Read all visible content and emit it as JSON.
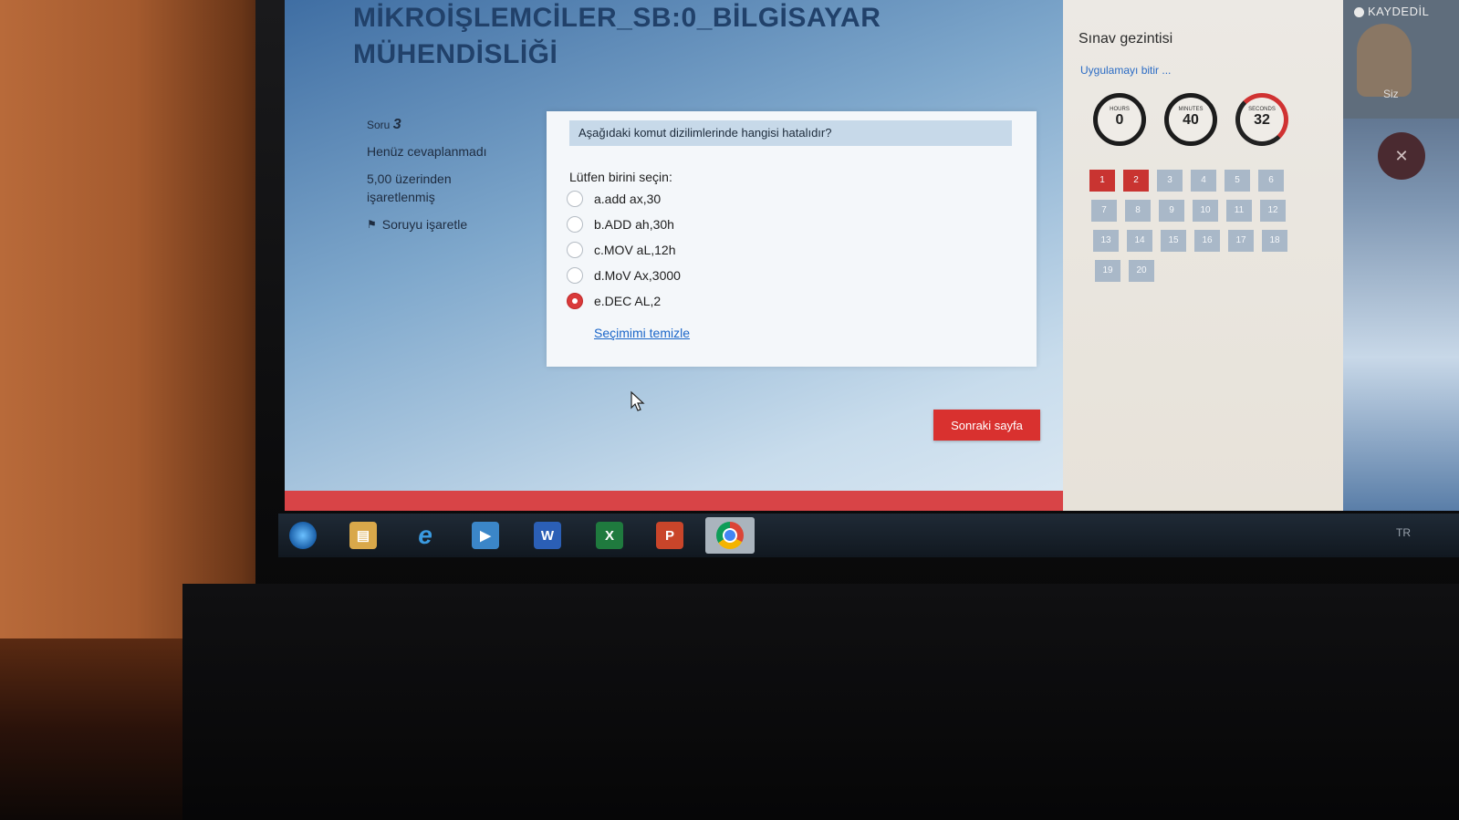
{
  "page": {
    "title_line1": "MİKROİŞLEMCİLER_SB:0_BİLGİSAYAR",
    "title_line2": "MÜHENDİSLİĞİ"
  },
  "question_info": {
    "soru_label": "Soru",
    "soru_number": "3",
    "status": "Henüz cevaplanmadı",
    "points_line1": "5,00 üzerinden",
    "points_line2": "işaretlenmiş",
    "flag_label": "Soruyu işaretle"
  },
  "question": {
    "text": "Aşağıdaki komut dizilimlerinde hangisi hatalıdır?",
    "prompt": "Lütfen birini seçin:",
    "options": [
      {
        "label": "a.add ax,30",
        "checked": false
      },
      {
        "label": "b.ADD ah,30h",
        "checked": false
      },
      {
        "label": "c.MOV aL,12h",
        "checked": false
      },
      {
        "label": "d.MoV Ax,3000",
        "checked": false
      },
      {
        "label": "e.DEC AL,2",
        "checked": true
      }
    ],
    "clear_link": "Seçimimi temizle",
    "next_button": "Sonraki sayfa"
  },
  "navigation": {
    "title": "Sınav gezintisi",
    "finish_link": "Uygulamayı bitir ...",
    "timer": {
      "hours_label": "HOURS",
      "hours": "0",
      "minutes_label": "MINUTES",
      "minutes": "40",
      "seconds_label": "SECONDS",
      "seconds": "32"
    },
    "question_buttons": [
      {
        "n": "1",
        "state": "red"
      },
      {
        "n": "2",
        "state": "red"
      },
      {
        "n": "3",
        "state": "normal"
      },
      {
        "n": "4",
        "state": "normal"
      },
      {
        "n": "5",
        "state": "normal"
      },
      {
        "n": "6",
        "state": "normal"
      },
      {
        "n": "7",
        "state": "normal"
      },
      {
        "n": "8",
        "state": "normal"
      },
      {
        "n": "9",
        "state": "normal"
      },
      {
        "n": "10",
        "state": "normal"
      },
      {
        "n": "11",
        "state": "normal"
      },
      {
        "n": "12",
        "state": "normal"
      },
      {
        "n": "13",
        "state": "normal"
      },
      {
        "n": "14",
        "state": "normal"
      },
      {
        "n": "15",
        "state": "normal"
      },
      {
        "n": "16",
        "state": "normal"
      },
      {
        "n": "17",
        "state": "normal"
      },
      {
        "n": "18",
        "state": "normal"
      },
      {
        "n": "19",
        "state": "normal"
      },
      {
        "n": "20",
        "state": "normal"
      }
    ]
  },
  "video_call": {
    "recording_label": "KAYDEDİL",
    "self_label": "Siz"
  },
  "taskbar": {
    "items": [
      {
        "name": "start-orb-icon",
        "glyph": "",
        "color": "#2e7fd0"
      },
      {
        "name": "file-explorer-icon",
        "glyph": "▤",
        "color": "#d9a84a"
      },
      {
        "name": "internet-explorer-icon",
        "glyph": "e",
        "color": "#2f8fdc"
      },
      {
        "name": "media-player-icon",
        "glyph": "▶",
        "color": "#3b86c8"
      },
      {
        "name": "word-icon",
        "glyph": "W",
        "color": "#2b5fb6"
      },
      {
        "name": "excel-icon",
        "glyph": "X",
        "color": "#1f7a3e"
      },
      {
        "name": "powerpoint-icon",
        "glyph": "P",
        "color": "#c9452a"
      },
      {
        "name": "chrome-icon",
        "glyph": "◉",
        "color": "#3a8a3a"
      }
    ],
    "language": "TR"
  }
}
